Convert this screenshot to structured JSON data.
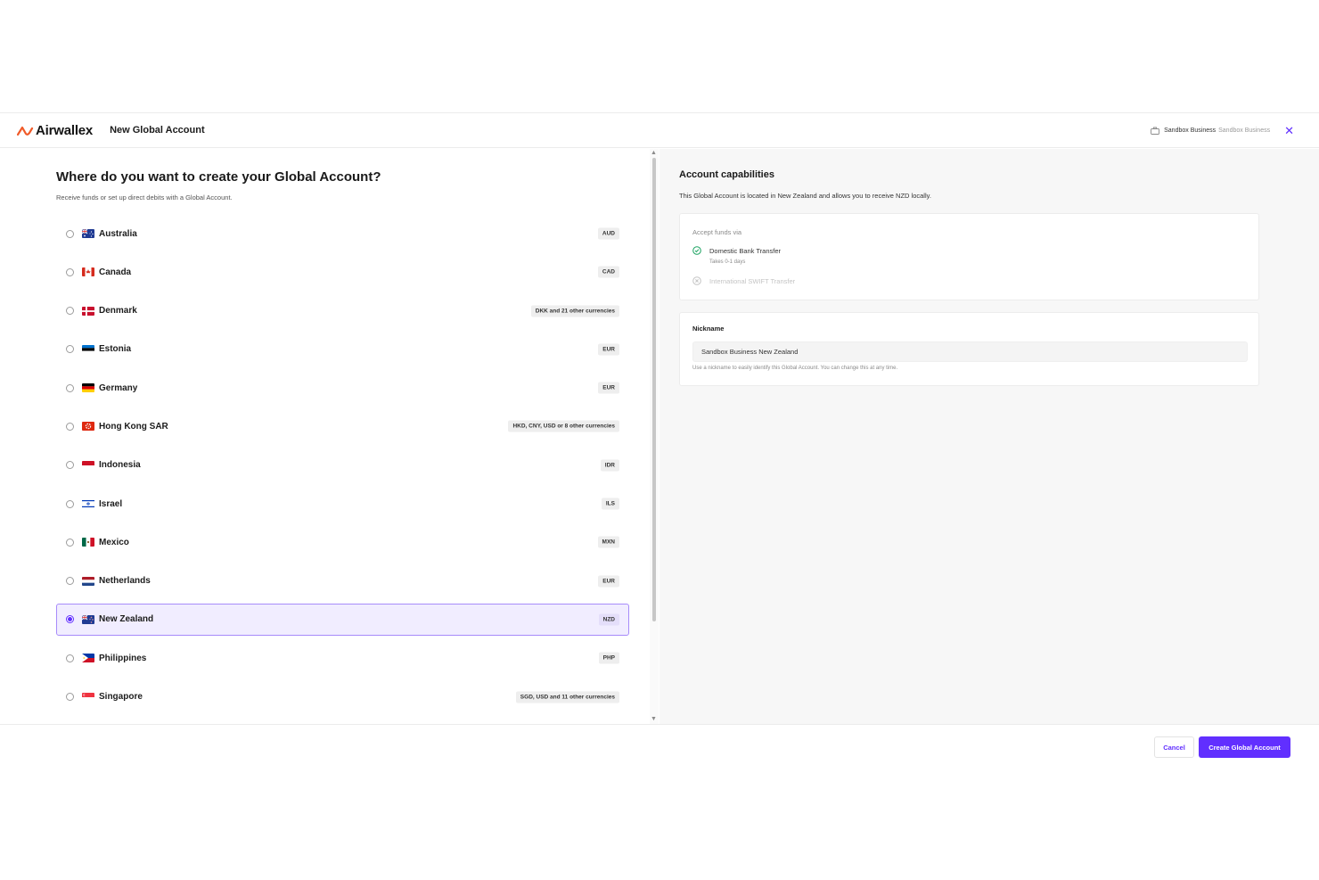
{
  "header": {
    "brand": "Airwallex",
    "title": "New Global Account",
    "business_name": "Sandbox Business",
    "business_sub": "Sandbox Business",
    "close_icon": "close-icon"
  },
  "left": {
    "question": "Where do you want to create your Global Account?",
    "subtitle": "Receive funds or set up direct debits with a Global Account.",
    "countries": [
      {
        "name": "Australia",
        "badge": "AUD",
        "flag": "au"
      },
      {
        "name": "Canada",
        "badge": "CAD",
        "flag": "ca"
      },
      {
        "name": "Denmark",
        "badge": "DKK and 21 other currencies",
        "flag": "dk"
      },
      {
        "name": "Estonia",
        "badge": "EUR",
        "flag": "ee"
      },
      {
        "name": "Germany",
        "badge": "EUR",
        "flag": "de"
      },
      {
        "name": "Hong Kong SAR",
        "badge": "HKD, CNY, USD or 8 other currencies",
        "flag": "hk"
      },
      {
        "name": "Indonesia",
        "badge": "IDR",
        "flag": "id"
      },
      {
        "name": "Israel",
        "badge": "ILS",
        "flag": "il"
      },
      {
        "name": "Mexico",
        "badge": "MXN",
        "flag": "mx"
      },
      {
        "name": "Netherlands",
        "badge": "EUR",
        "flag": "nl"
      },
      {
        "name": "New Zealand",
        "badge": "NZD",
        "flag": "nz"
      },
      {
        "name": "Philippines",
        "badge": "PHP",
        "flag": "ph"
      },
      {
        "name": "Singapore",
        "badge": "SGD, USD and 11 other currencies",
        "flag": "sg"
      }
    ],
    "selected": "New Zealand"
  },
  "right": {
    "title": "Account capabilities",
    "description": "This Global Account is located in New Zealand and allows you to receive NZD locally.",
    "accept_label": "Accept funds via",
    "methods": [
      {
        "name": "Domestic Bank Transfer",
        "time": "Takes 0-1 days",
        "enabled": true
      },
      {
        "name": "International SWIFT Transfer",
        "enabled": false
      }
    ],
    "nickname": {
      "label": "Nickname",
      "value": "Sandbox Business New Zealand",
      "help": "Use a nickname to easily identify this Global Account. You can change this at any time."
    }
  },
  "footer": {
    "cancel_label": "Cancel",
    "create_label": "Create Global Account"
  },
  "colors": {
    "accent": "#612fff",
    "selected_bg": "#f1edff",
    "success": "#1aa260"
  }
}
